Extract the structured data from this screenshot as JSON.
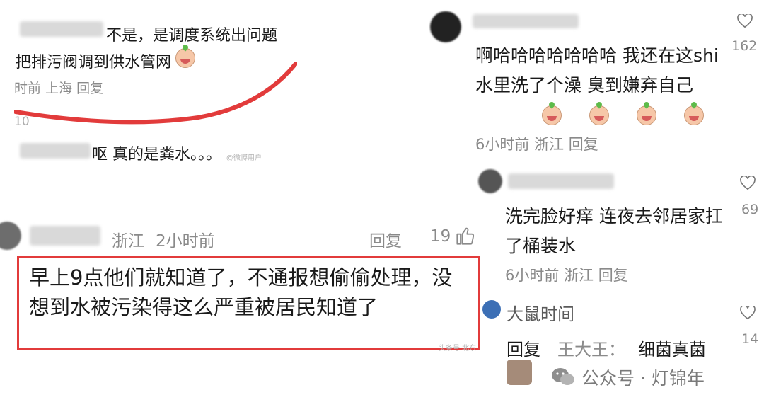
{
  "top_left_card": {
    "reply_text": "不是，是调度系统出问题",
    "reply_text2": "把排污阀调到供水管网",
    "meta": "时前 上海 回复",
    "count": "10",
    "second_text": "呕 真的是粪水。。。",
    "watermark": "@微博用户"
  },
  "middle_left": {
    "location": "浙江",
    "time": "2小时前",
    "reply_label": "回复",
    "likes": "19",
    "highlight_text": "早上9点他们就知道了，不通报想偷偷处理，没想到水被污染得这么严重被居民知道了",
    "watermark": "头条号·北东"
  },
  "right_column": {
    "comment1": {
      "text": "啊哈哈哈哈哈哈哈 我还在这shi水里洗了个澡 臭到嫌弃自己",
      "meta": "6小时前 浙江 回复",
      "likes": "162"
    },
    "comment2": {
      "text": "洗完脸好痒 连夜去邻居家扛了桶装水",
      "meta": "6小时前 浙江 回复",
      "likes": "69"
    },
    "comment3": {
      "username": "大鼠时间",
      "reply_label": "回复",
      "reply_target": "王大王：",
      "text": "细菌真菌",
      "likes": "14"
    }
  },
  "footer": {
    "account": "公众号 · 灯锦年"
  },
  "colors": {
    "highlight_border": "#e23b3b",
    "meta_gray": "#8a8a8a",
    "text": "#1a1a1a"
  }
}
